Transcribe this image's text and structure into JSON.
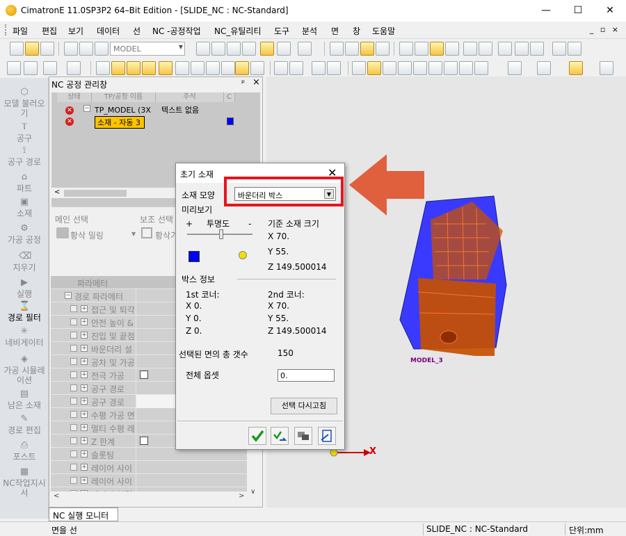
{
  "window": {
    "title": "CimatronE 11.0SP3P2 64–Bit Edition - [SLIDE_NC : NC-Standard]",
    "controls": [
      "—",
      "☐",
      "✕"
    ]
  },
  "menubar": {
    "items": [
      "파일",
      "편집",
      "보기",
      "데이터",
      "선",
      "NC -공정작업",
      "NC_유틸리티",
      "도구",
      "분석",
      "면",
      "창",
      "도움말"
    ],
    "mdi_controls": "_ ▫ ×"
  },
  "toolbar": {
    "model_combo": "MODEL"
  },
  "leftbar": {
    "items": [
      {
        "label": "모델 불러오기",
        "icon": "model-load-icon"
      },
      {
        "label": "공구",
        "icon": "tool-icon"
      },
      {
        "label": "공구 경로",
        "icon": "toolpath-icon"
      },
      {
        "label": "파트",
        "icon": "part-icon"
      },
      {
        "label": "소재",
        "icon": "stock-icon"
      },
      {
        "label": "가공 공정",
        "icon": "procedure-icon"
      },
      {
        "label": "지우기",
        "icon": "erase-icon"
      },
      {
        "label": "실행",
        "icon": "run-icon"
      },
      {
        "label": "경로 필터",
        "icon": "filter-icon"
      },
      {
        "label": "네비게이터",
        "icon": "navigator-icon"
      },
      {
        "label": "가공 시뮬레이션",
        "icon": "simulation-icon"
      },
      {
        "label": "남은 소재",
        "icon": "remaining-stock-icon"
      },
      {
        "label": "경로 편집",
        "icon": "path-edit-icon"
      },
      {
        "label": "포스트",
        "icon": "post-icon"
      },
      {
        "label": "NC작업지시서",
        "icon": "nc-sheet-icon"
      }
    ]
  },
  "ncpanel": {
    "title": "NC 공정 관리창",
    "pin": "ᵖ",
    "close": "×",
    "columns": [
      "상태",
      "TP/공정 이름",
      "주석",
      "C"
    ],
    "rows": [
      {
        "name": "TP_MODEL (3X",
        "comment": "텍스트 없음"
      },
      {
        "name": "소재 - 자동 3"
      }
    ],
    "main_select_label": "메인 선택",
    "main_select_value": "황삭 밀링",
    "sub_select_label": "보조 선택",
    "sub_select_value": "황삭가",
    "param_header": "파라메터",
    "params": [
      "경로 파라메터",
      "접근 및 퇴각",
      "안전 높이 &",
      "진입 및 끝점",
      "바운더리 설",
      "공차 및 가공",
      "전극 가공",
      "공구 경로",
      "공구 경로",
      "수평 가공 면",
      "멀티 수평 레",
      "Z 한계",
      "슬롯팅",
      "레이어 사이",
      "레이어 사이",
      "레이어 연결"
    ]
  },
  "dialog": {
    "title": "초기 소재",
    "shape_label": "소재 모양",
    "shape_value": "바운더리 박스",
    "preview_label": "미리보기",
    "plus": "+",
    "transparency": "투명도",
    "minus": "-",
    "ref_size_label": "기준 소재 크기",
    "ref_x": "X 70.",
    "ref_y": "Y 55.",
    "ref_z": "Z 149.500014",
    "box_info": "박스 정보",
    "corner1_label": "1st 코너:",
    "c1x": "X 0.",
    "c1y": "Y 0.",
    "c1z": "Z 0.",
    "corner2_label": "2nd 코너:",
    "c2x": "X 70.",
    "c2y": "Y 55.",
    "c2z": "Z 149.500014",
    "faces_label": "선택된 면의 총 갯수",
    "faces_value": "150",
    "offset_label": "전체 옵셋",
    "offset_value": "0.",
    "reselect": "선택 다시고침",
    "color": "#0000ff"
  },
  "viewport": {
    "model_label": "MODEL_3",
    "axis_x": "X",
    "stock_color": "#3a3aff",
    "part_color": "#c85000"
  },
  "bottom": {
    "tab": "NC 실행 모니터",
    "status_left": "면을 선",
    "status_doc": "SLIDE_NC : NC-Standard",
    "status_unit": "단위:mm"
  },
  "annotation": {
    "highlight_color": "#e8141c",
    "arrow_color": "#e0603e"
  }
}
